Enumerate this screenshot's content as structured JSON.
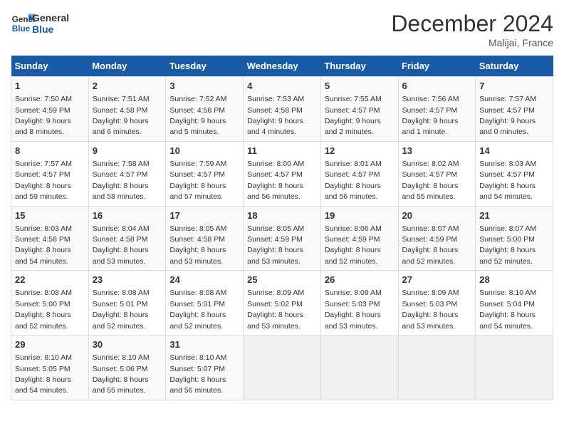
{
  "logo": {
    "line1": "General",
    "line2": "Blue"
  },
  "title": "December 2024",
  "location": "Malijai, France",
  "days_header": [
    "Sunday",
    "Monday",
    "Tuesday",
    "Wednesday",
    "Thursday",
    "Friday",
    "Saturday"
  ],
  "weeks": [
    [
      {
        "day": "1",
        "info": "Sunrise: 7:50 AM\nSunset: 4:59 PM\nDaylight: 9 hours\nand 8 minutes."
      },
      {
        "day": "2",
        "info": "Sunrise: 7:51 AM\nSunset: 4:58 PM\nDaylight: 9 hours\nand 6 minutes."
      },
      {
        "day": "3",
        "info": "Sunrise: 7:52 AM\nSunset: 4:58 PM\nDaylight: 9 hours\nand 5 minutes."
      },
      {
        "day": "4",
        "info": "Sunrise: 7:53 AM\nSunset: 4:58 PM\nDaylight: 9 hours\nand 4 minutes."
      },
      {
        "day": "5",
        "info": "Sunrise: 7:55 AM\nSunset: 4:57 PM\nDaylight: 9 hours\nand 2 minutes."
      },
      {
        "day": "6",
        "info": "Sunrise: 7:56 AM\nSunset: 4:57 PM\nDaylight: 9 hours\nand 1 minute."
      },
      {
        "day": "7",
        "info": "Sunrise: 7:57 AM\nSunset: 4:57 PM\nDaylight: 9 hours\nand 0 minutes."
      }
    ],
    [
      {
        "day": "8",
        "info": "Sunrise: 7:57 AM\nSunset: 4:57 PM\nDaylight: 8 hours\nand 59 minutes."
      },
      {
        "day": "9",
        "info": "Sunrise: 7:58 AM\nSunset: 4:57 PM\nDaylight: 8 hours\nand 58 minutes."
      },
      {
        "day": "10",
        "info": "Sunrise: 7:59 AM\nSunset: 4:57 PM\nDaylight: 8 hours\nand 57 minutes."
      },
      {
        "day": "11",
        "info": "Sunrise: 8:00 AM\nSunset: 4:57 PM\nDaylight: 8 hours\nand 56 minutes."
      },
      {
        "day": "12",
        "info": "Sunrise: 8:01 AM\nSunset: 4:57 PM\nDaylight: 8 hours\nand 56 minutes."
      },
      {
        "day": "13",
        "info": "Sunrise: 8:02 AM\nSunset: 4:57 PM\nDaylight: 8 hours\nand 55 minutes."
      },
      {
        "day": "14",
        "info": "Sunrise: 8:03 AM\nSunset: 4:57 PM\nDaylight: 8 hours\nand 54 minutes."
      }
    ],
    [
      {
        "day": "15",
        "info": "Sunrise: 8:03 AM\nSunset: 4:58 PM\nDaylight: 8 hours\nand 54 minutes."
      },
      {
        "day": "16",
        "info": "Sunrise: 8:04 AM\nSunset: 4:58 PM\nDaylight: 8 hours\nand 53 minutes."
      },
      {
        "day": "17",
        "info": "Sunrise: 8:05 AM\nSunset: 4:58 PM\nDaylight: 8 hours\nand 53 minutes."
      },
      {
        "day": "18",
        "info": "Sunrise: 8:05 AM\nSunset: 4:59 PM\nDaylight: 8 hours\nand 53 minutes."
      },
      {
        "day": "19",
        "info": "Sunrise: 8:06 AM\nSunset: 4:59 PM\nDaylight: 8 hours\nand 52 minutes."
      },
      {
        "day": "20",
        "info": "Sunrise: 8:07 AM\nSunset: 4:59 PM\nDaylight: 8 hours\nand 52 minutes."
      },
      {
        "day": "21",
        "info": "Sunrise: 8:07 AM\nSunset: 5:00 PM\nDaylight: 8 hours\nand 52 minutes."
      }
    ],
    [
      {
        "day": "22",
        "info": "Sunrise: 8:08 AM\nSunset: 5:00 PM\nDaylight: 8 hours\nand 52 minutes."
      },
      {
        "day": "23",
        "info": "Sunrise: 8:08 AM\nSunset: 5:01 PM\nDaylight: 8 hours\nand 52 minutes."
      },
      {
        "day": "24",
        "info": "Sunrise: 8:08 AM\nSunset: 5:01 PM\nDaylight: 8 hours\nand 52 minutes."
      },
      {
        "day": "25",
        "info": "Sunrise: 8:09 AM\nSunset: 5:02 PM\nDaylight: 8 hours\nand 53 minutes."
      },
      {
        "day": "26",
        "info": "Sunrise: 8:09 AM\nSunset: 5:03 PM\nDaylight: 8 hours\nand 53 minutes."
      },
      {
        "day": "27",
        "info": "Sunrise: 8:09 AM\nSunset: 5:03 PM\nDaylight: 8 hours\nand 53 minutes."
      },
      {
        "day": "28",
        "info": "Sunrise: 8:10 AM\nSunset: 5:04 PM\nDaylight: 8 hours\nand 54 minutes."
      }
    ],
    [
      {
        "day": "29",
        "info": "Sunrise: 8:10 AM\nSunset: 5:05 PM\nDaylight: 8 hours\nand 54 minutes."
      },
      {
        "day": "30",
        "info": "Sunrise: 8:10 AM\nSunset: 5:06 PM\nDaylight: 8 hours\nand 55 minutes."
      },
      {
        "day": "31",
        "info": "Sunrise: 8:10 AM\nSunset: 5:07 PM\nDaylight: 8 hours\nand 56 minutes."
      },
      {
        "day": "",
        "info": ""
      },
      {
        "day": "",
        "info": ""
      },
      {
        "day": "",
        "info": ""
      },
      {
        "day": "",
        "info": ""
      }
    ]
  ]
}
